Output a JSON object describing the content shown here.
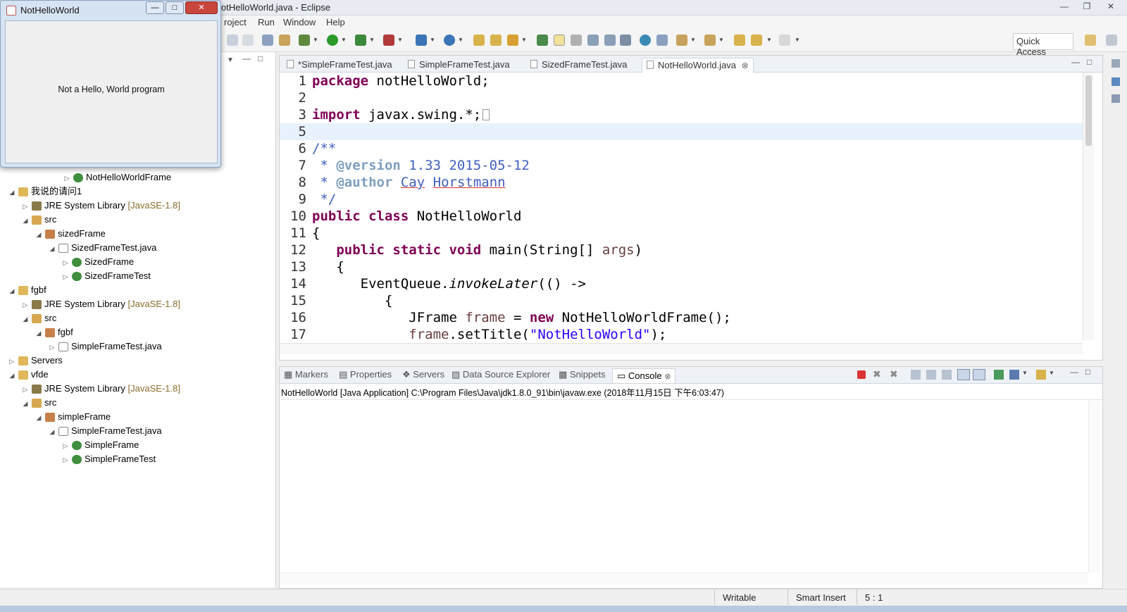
{
  "window": {
    "title": "otHelloWorld.java - Eclipse"
  },
  "menu": [
    "roject",
    "Run",
    "Window",
    "Help"
  ],
  "quick_access": "Quick Access",
  "tree": [
    {
      "label": "NotHelloWorldFrame",
      "extra": ""
    },
    {
      "label": "我说的请问1",
      "extra": ""
    },
    {
      "label": "JRE System Library",
      "extra": "[JavaSE-1.8]"
    },
    {
      "label": "src",
      "extra": ""
    },
    {
      "label": "sizedFrame",
      "extra": ""
    },
    {
      "label": "SizedFrameTest.java",
      "extra": ""
    },
    {
      "label": "SizedFrame",
      "extra": ""
    },
    {
      "label": "SizedFrameTest",
      "extra": ""
    },
    {
      "label": "fgbf",
      "extra": ""
    },
    {
      "label": "JRE System Library",
      "extra": "[JavaSE-1.8]"
    },
    {
      "label": "src",
      "extra": ""
    },
    {
      "label": "fgbf",
      "extra": ""
    },
    {
      "label": "SimpleFrameTest.java",
      "extra": ""
    },
    {
      "label": "Servers",
      "extra": ""
    },
    {
      "label": "vfde",
      "extra": ""
    },
    {
      "label": "JRE System Library",
      "extra": "[JavaSE-1.8]"
    },
    {
      "label": "src",
      "extra": ""
    },
    {
      "label": "simpleFrame",
      "extra": ""
    },
    {
      "label": "SimpleFrameTest.java",
      "extra": ""
    },
    {
      "label": "SimpleFrame",
      "extra": ""
    },
    {
      "label": "SimpleFrameTest",
      "extra": ""
    }
  ],
  "editor_tabs": [
    "*SimpleFrameTest.java",
    "SimpleFrameTest.java",
    "SizedFrameTest.java",
    "NotHelloWorld.java"
  ],
  "code": [
    {
      "n": "1",
      "t": "package notHelloWorld;"
    },
    {
      "n": "2",
      "t": ""
    },
    {
      "n": "3",
      "t": "import javax.swing.*;"
    },
    {
      "n": "5",
      "t": ""
    },
    {
      "n": "6",
      "t": "/**"
    },
    {
      "n": "7",
      "t": " * @version 1.33 2015-05-12"
    },
    {
      "n": "8",
      "t": " * @author Cay Horstmann"
    },
    {
      "n": "9",
      "t": " */"
    },
    {
      "n": "10",
      "t": "public class NotHelloWorld"
    },
    {
      "n": "11",
      "t": "{"
    },
    {
      "n": "12",
      "t": "   public static void main(String[] args)"
    },
    {
      "n": "13",
      "t": "   {"
    },
    {
      "n": "14",
      "t": "      EventQueue.invokeLater(() ->"
    },
    {
      "n": "15",
      "t": "         {"
    },
    {
      "n": "16",
      "t": "            JFrame frame = new NotHelloWorldFrame();"
    },
    {
      "n": "17",
      "t": "            frame.setTitle(\"NotHelloWorld\");"
    }
  ],
  "bottom_tabs": [
    "Markers",
    "Properties",
    "Servers",
    "Data Source Explorer",
    "Snippets",
    "Console"
  ],
  "console_header": "NotHelloWorld [Java Application] C:\\Program Files\\Java\\jdk1.8.0_91\\bin\\javaw.exe (2018年11月15日 下午6:03:47)",
  "status": {
    "writable": "Writable",
    "insert_mode": "Smart Insert",
    "position": "5 : 1"
  },
  "swing_window": {
    "title": "NotHelloWorld",
    "label": "Not a Hello, World program"
  },
  "colors": {
    "keyword": "#7f0055",
    "comment": "#3f5fbf",
    "string": "#2a00ff",
    "highlight_line": "#e8f2fe"
  }
}
